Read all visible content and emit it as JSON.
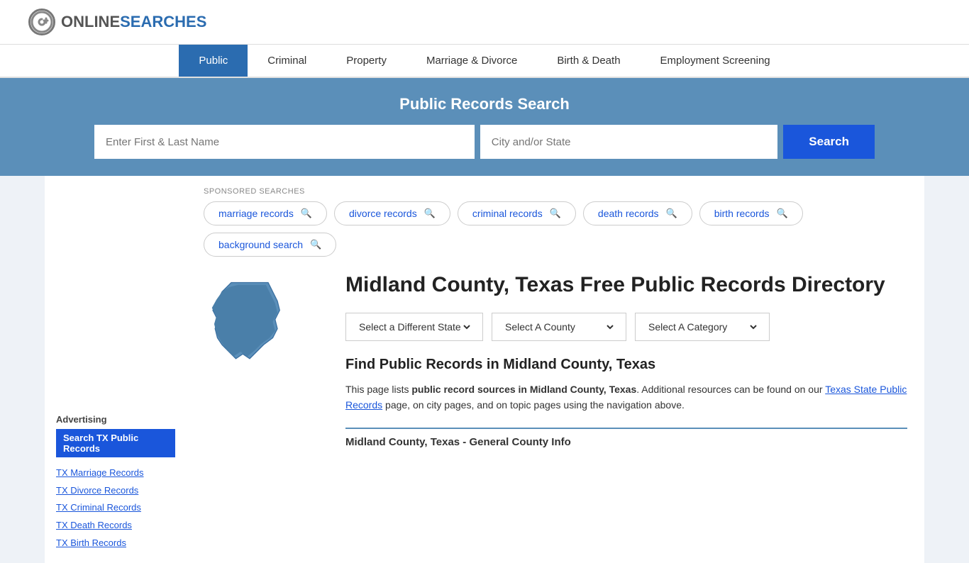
{
  "logo": {
    "icon_text": "G",
    "text_online": "ONLINE",
    "text_searches": "SEARCHES"
  },
  "nav": {
    "items": [
      {
        "label": "Public",
        "active": true
      },
      {
        "label": "Criminal",
        "active": false
      },
      {
        "label": "Property",
        "active": false
      },
      {
        "label": "Marriage & Divorce",
        "active": false
      },
      {
        "label": "Birth & Death",
        "active": false
      },
      {
        "label": "Employment Screening",
        "active": false
      }
    ]
  },
  "search_banner": {
    "title": "Public Records Search",
    "name_placeholder": "Enter First & Last Name",
    "location_placeholder": "City and/or State",
    "button_label": "Search"
  },
  "sponsored": {
    "label": "SPONSORED SEARCHES",
    "tags": [
      {
        "label": "marriage records"
      },
      {
        "label": "divorce records"
      },
      {
        "label": "criminal records"
      },
      {
        "label": "death records"
      },
      {
        "label": "birth records"
      },
      {
        "label": "background search"
      }
    ]
  },
  "sidebar": {
    "advertising_label": "Advertising",
    "ad_button_label": "Search TX Public Records",
    "links": [
      {
        "label": "TX Marriage Records"
      },
      {
        "label": "TX Divorce Records"
      },
      {
        "label": "TX Criminal Records"
      },
      {
        "label": "TX Death Records"
      },
      {
        "label": "TX Birth Records"
      }
    ]
  },
  "content": {
    "county_title": "Midland County, Texas Free Public Records Directory",
    "dropdowns": {
      "state_label": "Select a Different State",
      "county_label": "Select A County",
      "category_label": "Select A Category"
    },
    "find_title": "Find Public Records in Midland County, Texas",
    "find_description_1": "This page lists ",
    "find_description_bold": "public record sources in Midland County, Texas",
    "find_description_2": ". Additional resources can be found on our ",
    "find_link_text": "Texas State Public Records",
    "find_description_3": " page, on city pages, and on topic pages using the navigation above.",
    "section_divider_label": "Midland County, Texas - General County Info"
  }
}
